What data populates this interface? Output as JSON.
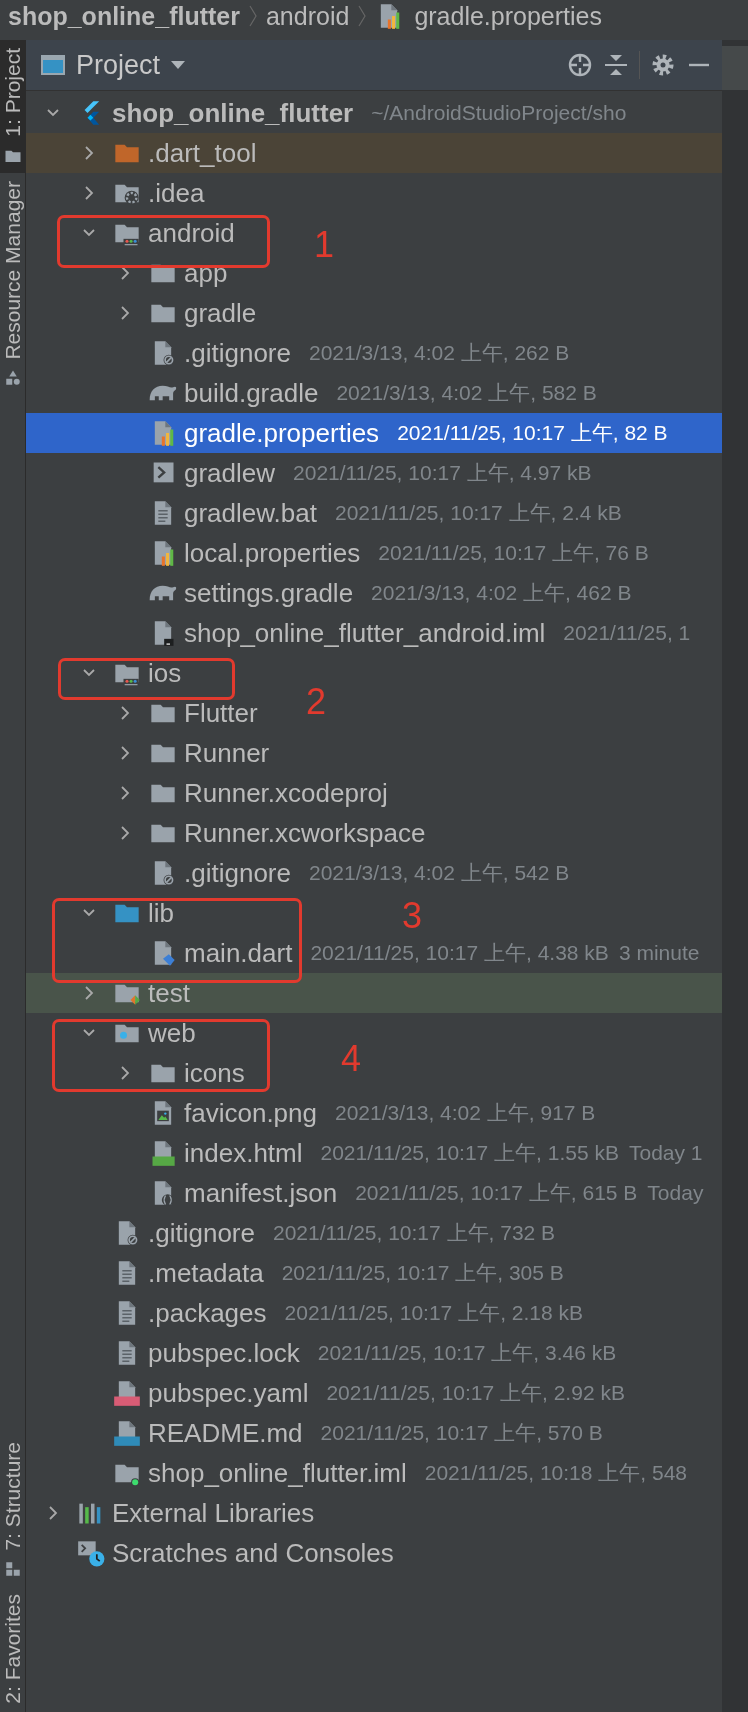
{
  "breadcrumb": [
    {
      "label": "shop_online_flutter",
      "bold": true
    },
    {
      "label": "android",
      "bold": false
    },
    {
      "label": "gradle.properties",
      "bold": false,
      "kind": "properties"
    }
  ],
  "left_tabs": [
    {
      "label": "1: Project",
      "selected": true,
      "kind": "folder"
    },
    {
      "label": "Resource Manager",
      "selected": false,
      "kind": "shapes"
    },
    {
      "label": "7: Structure",
      "selected": false,
      "kind": "structure"
    },
    {
      "label": "2: Favorites",
      "selected": false
    }
  ],
  "panel": {
    "title": "Project"
  },
  "tree": [
    {
      "name": "shop_online_flutter",
      "bold": true,
      "info": "~/AndroidStudioProject/sho",
      "kind": "flutter",
      "expanded": true,
      "selected": false,
      "children": [
        {
          "name": ".dart_tool",
          "kind": "folder-excluded",
          "expanded": false,
          "selected": false,
          "color": "#4b4437"
        },
        {
          "name": ".idea",
          "kind": "folder-idea",
          "expanded": false,
          "selected": false
        },
        {
          "name": "android",
          "kind": "folder-module",
          "expanded": true,
          "selected": false,
          "children": [
            {
              "name": "app",
              "kind": "folder",
              "expanded": false,
              "selected": false
            },
            {
              "name": "gradle",
              "kind": "folder",
              "expanded": false,
              "selected": false
            },
            {
              "name": ".gitignore",
              "kind": "gitignore",
              "info": "2021/3/13, 4:02 上午, 262 B",
              "selected": false
            },
            {
              "name": "build.gradle",
              "kind": "gradle",
              "info": "2021/3/13, 4:02 上午, 582 B",
              "selected": false
            },
            {
              "name": "gradle.properties",
              "kind": "properties",
              "info": "2021/11/25, 10:17 上午, 82 B",
              "selected": true
            },
            {
              "name": "gradlew",
              "kind": "shell",
              "info": "2021/11/25, 10:17 上午, 4.97 kB",
              "selected": false
            },
            {
              "name": "gradlew.bat",
              "kind": "text",
              "info": "2021/11/25, 10:17 上午, 2.4 kB",
              "selected": false
            },
            {
              "name": "local.properties",
              "kind": "properties",
              "info": "2021/11/25, 10:17 上午, 76 B",
              "selected": false
            },
            {
              "name": "settings.gradle",
              "kind": "gradle",
              "info": "2021/3/13, 4:02 上午, 462 B",
              "selected": false
            },
            {
              "name": "shop_online_flutter_android.iml",
              "kind": "iml",
              "info": "2021/11/25, 1",
              "selected": false
            }
          ]
        },
        {
          "name": "ios",
          "kind": "folder-module",
          "expanded": true,
          "selected": false,
          "children": [
            {
              "name": "Flutter",
              "kind": "folder",
              "expanded": false,
              "selected": false
            },
            {
              "name": "Runner",
              "kind": "folder",
              "expanded": false,
              "selected": false
            },
            {
              "name": "Runner.xcodeproj",
              "kind": "folder",
              "expanded": false,
              "selected": false
            },
            {
              "name": "Runner.xcworkspace",
              "kind": "folder",
              "expanded": false,
              "selected": false
            },
            {
              "name": ".gitignore",
              "kind": "gitignore",
              "info": "2021/3/13, 4:02 上午, 542 B",
              "selected": false
            }
          ]
        },
        {
          "name": "lib",
          "kind": "folder-source",
          "expanded": true,
          "selected": false,
          "children": [
            {
              "name": "main.dart",
              "kind": "dart",
              "info": "2021/11/25, 10:17 上午, 4.38 kB",
              "note": "3 minute",
              "selected": false
            }
          ]
        },
        {
          "name": "test",
          "kind": "folder-test",
          "expanded": false,
          "selected": false,
          "color": "#49544a"
        },
        {
          "name": "web",
          "kind": "folder-web",
          "expanded": true,
          "selected": false,
          "children": [
            {
              "name": "icons",
              "kind": "folder",
              "expanded": false,
              "selected": false
            },
            {
              "name": "favicon.png",
              "kind": "image",
              "info": "2021/3/13, 4:02 上午, 917 B",
              "selected": false
            },
            {
              "name": "index.html",
              "kind": "html",
              "info": "2021/11/25, 10:17 上午, 1.55 kB",
              "note": "Today 1",
              "selected": false
            },
            {
              "name": "manifest.json",
              "kind": "json",
              "info": "2021/11/25, 10:17 上午, 615 B",
              "note": "Today",
              "selected": false
            }
          ]
        },
        {
          "name": ".gitignore",
          "kind": "gitignore",
          "info": "2021/11/25, 10:17 上午, 732 B",
          "selected": false
        },
        {
          "name": ".metadata",
          "kind": "text",
          "info": "2021/11/25, 10:17 上午, 305 B",
          "selected": false
        },
        {
          "name": ".packages",
          "kind": "text",
          "info": "2021/11/25, 10:17 上午, 2.18 kB",
          "selected": false
        },
        {
          "name": "pubspec.lock",
          "kind": "text",
          "info": "2021/11/25, 10:17 上午, 3.46 kB",
          "selected": false
        },
        {
          "name": "pubspec.yaml",
          "kind": "yml",
          "info": "2021/11/25, 10:17 上午, 2.92 kB",
          "selected": false
        },
        {
          "name": "README.md",
          "kind": "md",
          "info": "2021/11/25, 10:17 上午, 570 B",
          "selected": false
        },
        {
          "name": "shop_online_flutter.iml",
          "kind": "module-iml",
          "info": "2021/11/25, 10:18 上午, 548",
          "selected": false
        }
      ]
    },
    {
      "name": "External Libraries",
      "kind": "libraries",
      "expanded": false,
      "selected": false
    },
    {
      "name": "Scratches and Consoles",
      "kind": "scratches",
      "selected": false
    }
  ],
  "annotations": [
    {
      "label": "1"
    },
    {
      "label": "2"
    },
    {
      "label": "3"
    },
    {
      "label": "4"
    }
  ]
}
